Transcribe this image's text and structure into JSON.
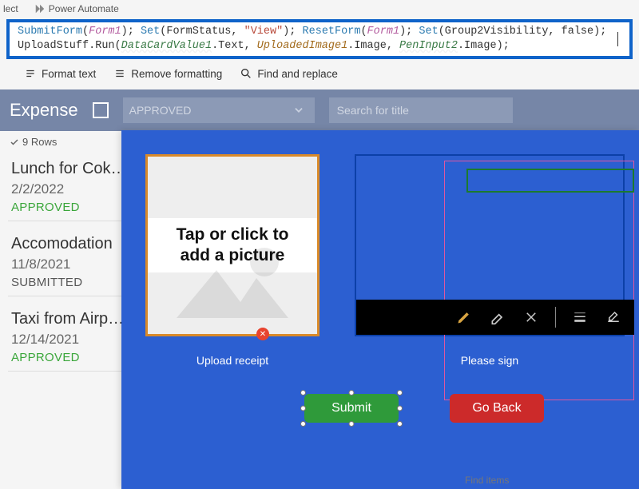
{
  "topmenu": {
    "item1": "lect",
    "item2": "Power Automate"
  },
  "formula": {
    "p1_fn1": "SubmitForm",
    "p1_id1": "Form1",
    "p1_fn2": "Set",
    "p1_arg2a": "FormStatus",
    "p1_str": "\"View\"",
    "p1_fn3": "ResetForm",
    "p1_id3": "Form1",
    "p1_fn4": "Set",
    "p1_arg4a": "Group2Visibility",
    "p1_arg4b": "false",
    "p2_obj": "UploadStuff",
    "p2_run": "Run",
    "p2_a1": "DataCardValue1",
    "p2_a1s": ".Text",
    "p2_a2": "UploadedImage1",
    "p2_a2s": ".Image",
    "p2_a3": "PenInput2",
    "p2_a3s": ".Image"
  },
  "toolbar2": {
    "format": "Format text",
    "remove": "Remove formatting",
    "find": "Find and replace"
  },
  "header": {
    "title": "Expense",
    "dropdown_label": "APPROVED",
    "search_placeholder": "Search for title"
  },
  "rows_label": "9 Rows",
  "cards": [
    {
      "title": "Lunch for Cok…",
      "date": "2/2/2022",
      "status": "APPROVED",
      "cls": "st-approved"
    },
    {
      "title": "Accomodation",
      "date": "11/8/2021",
      "status": "SUBMITTED",
      "cls": "st-submitted"
    },
    {
      "title": "Taxi from Airp…",
      "date": "12/14/2021",
      "status": "APPROVED",
      "cls": "st-approved"
    }
  ],
  "overlay": {
    "addpic_line1": "Tap or click to",
    "addpic_line2": "add a picture",
    "upload_label": "Upload receipt",
    "sign_label": "Please sign",
    "submit": "Submit",
    "goback": "Go Back",
    "finditems": "Find items"
  }
}
